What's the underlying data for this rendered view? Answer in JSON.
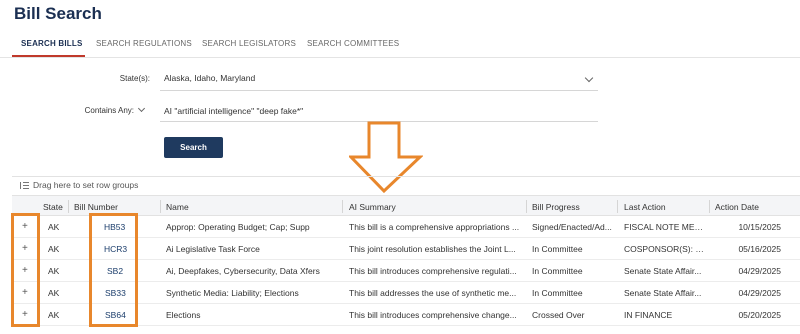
{
  "page": {
    "title": "Bill Search"
  },
  "tabs": [
    {
      "label": "SEARCH BILLS",
      "active": true
    },
    {
      "label": "SEARCH REGULATIONS",
      "active": false
    },
    {
      "label": "SEARCH LEGISLATORS",
      "active": false
    },
    {
      "label": "SEARCH COMMITTEES",
      "active": false
    }
  ],
  "form": {
    "state_label": "State(s):",
    "state_value": "Alaska, Idaho, Maryland",
    "contains_label": "Contains Any:",
    "contains_value": "AI \"artificial intelligence\" \"deep fake*\"",
    "search_button": "Search"
  },
  "grid": {
    "group_hint": "Drag here to set row groups",
    "columns": [
      "State",
      "Bill Number",
      "Name",
      "AI Summary",
      "Bill Progress",
      "Last Action",
      "Action Date"
    ],
    "rows": [
      {
        "state": "AK",
        "bill": "HB53",
        "name": "Approp: Operating Budget; Cap; Supp",
        "summary": "This bill is a comprehensive appropriations ...",
        "progress": "Signed/Enacted/Ad...",
        "last_action": "FISCAL NOTE MEM...",
        "date": "10/15/2025"
      },
      {
        "state": "AK",
        "bill": "HCR3",
        "name": "Ai Legislative Task Force",
        "summary": "This joint resolution establishes the Joint L...",
        "progress": "In Committee",
        "last_action": "COSPONSOR(S): H...",
        "date": "05/16/2025"
      },
      {
        "state": "AK",
        "bill": "SB2",
        "name": "Ai, Deepfakes, Cybersecurity, Data Xfers",
        "summary": "This bill introduces comprehensive regulati...",
        "progress": "In Committee",
        "last_action": "Senate State Affair...",
        "date": "04/29/2025"
      },
      {
        "state": "AK",
        "bill": "SB33",
        "name": "Synthetic Media: Liability; Elections",
        "summary": "This bill addresses the use of synthetic me...",
        "progress": "In Committee",
        "last_action": "Senate State Affair...",
        "date": "04/29/2025"
      },
      {
        "state": "AK",
        "bill": "SB64",
        "name": "Elections",
        "summary": "This bill introduces comprehensive change...",
        "progress": "Crossed Over",
        "last_action": "IN FINANCE",
        "date": "05/20/2025"
      }
    ]
  },
  "icons": {
    "expand": "plus-icon",
    "dropdown": "chevron-down-icon",
    "group": "row-group-icon"
  },
  "colors": {
    "title": "#1b2f52",
    "tab_active_underline": "#c0392b",
    "button": "#1f3a5f",
    "annotation": "#e8872c"
  }
}
